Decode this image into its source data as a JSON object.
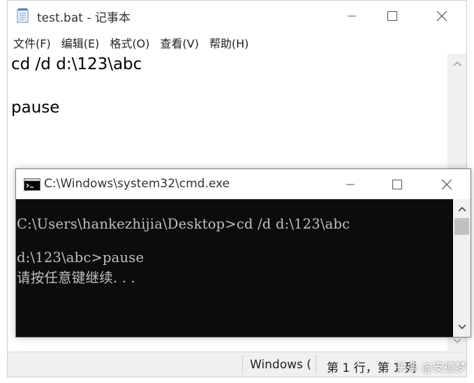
{
  "notepad": {
    "title": "test.bat - 记事本",
    "menu": [
      "文件(F)",
      "编辑(E)",
      "格式(O)",
      "查看(V)",
      "帮助(H)"
    ],
    "lines": [
      "cd /d d:\\123\\abc",
      "pause"
    ],
    "status": {
      "encoding": "Windows (",
      "position": "第 1 行，第 1 列"
    },
    "watermark": "头条 @安德梦"
  },
  "cmd": {
    "title": "C:\\Windows\\system32\\cmd.exe",
    "lines": [
      "C:\\Users\\hankezhijia\\Desktop>cd /d d:\\123\\abc",
      "d:\\123\\abc>pause",
      "请按任意键继续. . ."
    ]
  },
  "window_buttons": {
    "minimize": "—",
    "maximize": "☐",
    "close": "✕"
  }
}
